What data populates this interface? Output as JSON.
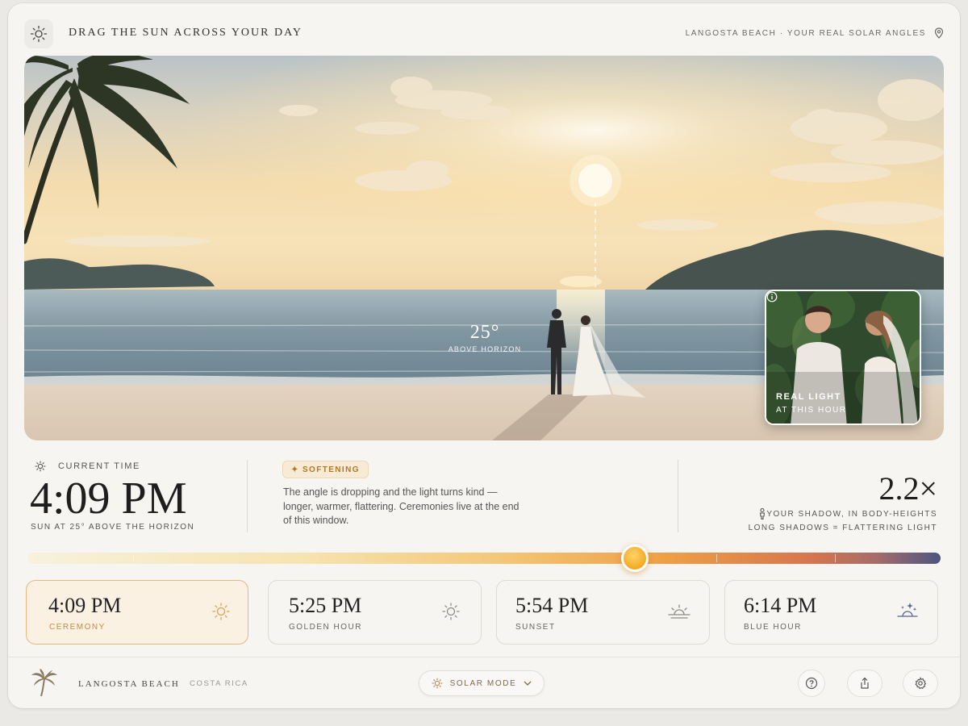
{
  "header": {
    "title": "DRAG THE SUN ACROSS YOUR DAY",
    "location": "LANGOSTA BEACH · YOUR REAL SOLAR ANGLES",
    "icons": [
      "sun-icon",
      "map-pin-icon"
    ]
  },
  "hero": {
    "sun_angle": "25°",
    "sun_angle_sub": "ABOVE HORIZON",
    "inset": {
      "line1": "REAL LIGHT",
      "line2": "AT THIS HOUR"
    }
  },
  "current": {
    "label": "CURRENT TIME",
    "time": "4:09 PM",
    "sub": "SUN AT 25° ABOVE THE HORIZON"
  },
  "phase": {
    "badge": "✦ SOFTENING",
    "description": "The angle is dropping and the light turns kind — longer, warmer, flattering. Ceremonies live at the end of this window."
  },
  "shadow": {
    "multiplier": "2.2×",
    "label": "YOUR SHADOW, IN BODY-HEIGHTS",
    "sub": "LONG SHADOWS = FLATTERING LIGHT"
  },
  "slider": {
    "value_fraction": 0.665
  },
  "cards": [
    {
      "time": "4:09 PM",
      "label": "CEREMONY",
      "icon": "sun-icon",
      "active": true
    },
    {
      "time": "5:25 PM",
      "label": "GOLDEN HOUR",
      "icon": "sun-icon",
      "active": false
    },
    {
      "time": "5:54 PM",
      "label": "SUNSET",
      "icon": "sunset-icon",
      "active": false
    },
    {
      "time": "6:14 PM",
      "label": "BLUE HOUR",
      "icon": "blue-hour-icon",
      "active": false
    }
  ],
  "footer": {
    "place": "LANGOSTA BEACH",
    "country": "COSTA RICA",
    "mode": "SOLAR MODE",
    "icons": [
      "palm-tree-icon",
      "help-icon",
      "share-icon",
      "settings-icon"
    ]
  },
  "colors": {
    "accent": "#e5b87b",
    "badge_text": "#b07828",
    "slider_start": "#f7f1de",
    "slider_mid": "#f3c777",
    "slider_end": "#4c5680"
  }
}
